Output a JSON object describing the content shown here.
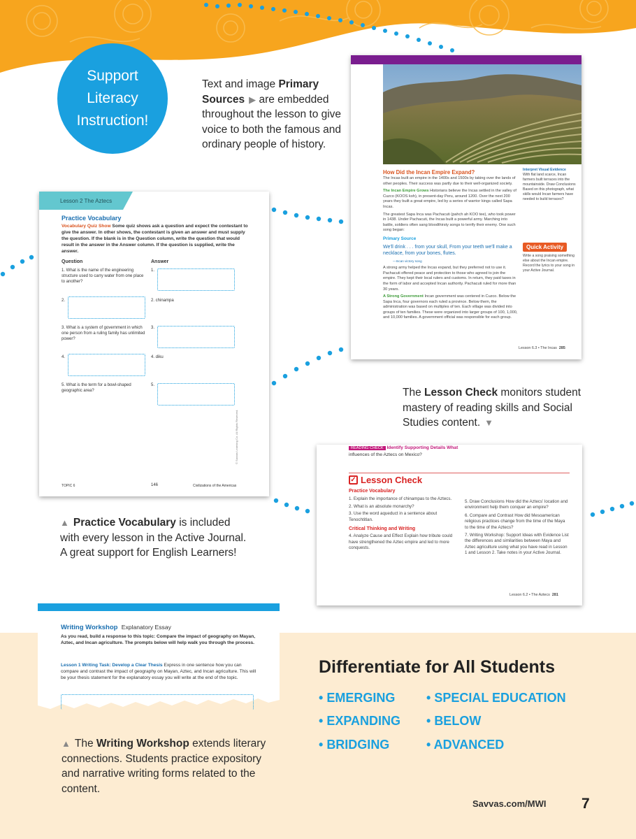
{
  "colors": {
    "orange": "#f7a51e",
    "blue": "#1aa0df",
    "teal": "#63c7cf",
    "red": "#d92323",
    "purple": "#7a1d8f",
    "cream": "#fdecd2"
  },
  "badge": {
    "line1": "Support",
    "line2": "Literacy",
    "line3": "Instruction!"
  },
  "captions": {
    "primary": {
      "pre": "Text and image ",
      "bold": "Primary Sources",
      "post": " are embedded throughout the lesson to give voice to both the famous and ordinary people of history.",
      "arrow_icon": "triangle-right-icon"
    },
    "lesson_check": {
      "pre": "The ",
      "bold": "Lesson Check",
      "post": " monitors student mastery of reading skills and Social Studies content.",
      "arrow_icon": "triangle-down-icon"
    },
    "practice": {
      "bold": "Practice Vocabulary",
      "post": " is included with every lesson in the Active Journal. A great support for English Learners!",
      "arrow_icon": "triangle-up-icon"
    },
    "writing": {
      "pre": "The ",
      "bold": "Writing Workshop",
      "post": " extends literary connections. Students practice expository and narrative writing forms related to the content.",
      "arrow_icon": "triangle-up-icon"
    }
  },
  "vocab_card": {
    "tab": "Lesson 2  The Aztecs",
    "title": "Practice Vocabulary",
    "lead": "Vocabulary Quiz Show",
    "instructions": " Some quiz shows ask a question and expect the contestant to give the answer. In other shows, the contestant is given an answer and must supply the question. If the blank is in the Question column, write the question that would result in the answer in the Answer column. If the question is supplied, write the answer.",
    "col_q": "Question",
    "col_a": "Answer",
    "rows": [
      {
        "q": "1. What is the name of the engineering structure used to carry water from one place to another?",
        "a": "1."
      },
      {
        "q": "2.",
        "a": "2. chinampa"
      },
      {
        "q": "3. What is a system of government in which one person from a ruling family has unlimited power?",
        "a": "3."
      },
      {
        "q": "4.",
        "a": "4. diku"
      },
      {
        "q": "5. What is the term for a bowl-shaped geographic area?",
        "a": "5."
      }
    ],
    "footer_left": "TOPIC 6",
    "footer_mid": "146",
    "footer_right": "Civilizations of the Americas",
    "copyright": "© Savvas Learning Co. All Rights Reserved."
  },
  "inca_card": {
    "heading": "How Did the Incan Empire Expand?",
    "p1": "The Incas built an empire in the 1400s and 1500s by taking over the lands of other peoples. Their success was partly due to their well-organized society.",
    "sub1": "The Incan Empire Grows",
    "p2": " Historians believe the Incas settled in the valley of Cuzco (KOOS koh), in present-day Peru, around 1200. Over the next 200 years they built a great empire, led by a series of warrior kings called Sapa Incas.",
    "p3": "The greatest Sapa Inca was Pachacuti (pahch ah KOO tee), who took power in 1438. Under Pachacuti, the Incas built a powerful army. Marching into battle, soldiers often sang bloodthirsty songs to terrify their enemy. One such song began:",
    "ps_label": "Primary Source",
    "quote": "We'll drink . . . from your skull, From your teeth we'll make a necklace, from your bones, flutes.",
    "quote_src": "—Incan victory song",
    "p4": "A strong army helped the Incas expand, but they preferred not to use it. Pachacuti offered peace and protection to those who agreed to join the empire. They kept their local rulers and customs. In return, they paid taxes in the form of labor and accepted Incan authority. Pachacuti ruled for more than 30 years.",
    "sub2": "A Strong Government",
    "p5": " Incan government was centered in Cuzco. Below the Sapa Inca, four governors each ruled a province. Below them, the administration was based on multiples of ten. Each village was divided into groups of ten families. These were organized into larger groups of 100, 1,000, and 10,000 families. A government official was responsible for each group.",
    "side_title": "Interpret Visual Evidence",
    "side_text": "With flat land scarce, Incan farmers built terraces into the mountainside. Draw Conclusions Based on this photograph, what skills would Incan farmers have needed to build terraces?",
    "quick_activity": "Quick Activity",
    "quick_text": "Write a song praising something else about the Incan empire. Record the lyrics to your song in your Active Journal.",
    "footer": "Lesson 6.3 • The Incas",
    "page": "285"
  },
  "lesson_check_card": {
    "reading_check": "READING CHECK",
    "rc_text": " Identify Supporting Details What",
    "rc_text2": "influences of the Aztecs on Mexico?",
    "title": "Lesson Check",
    "pv_head": "Practice Vocabulary",
    "items_left": [
      "1.  Explain the importance of chinampas to the Aztecs.",
      "2.  What is an absolute monarchy?",
      "3.  Use the word aqueduct in a sentence about Tenochtitlan."
    ],
    "ct_head": "Critical Thinking and Writing",
    "item4": "4.  Analyze Cause and Effect Explain how tribute could have strengthened the Aztec empire and led to more conquests.",
    "items_right": [
      "5.  Draw Conclusions How did the Aztecs' location and environment help them conquer an empire?",
      "6.  Compare and Contrast How did Mesoamerican religious practices change from the time of the Maya to the time of the Aztecs?",
      "7.  Writing Workshop: Support Ideas with Evidence List the differences and similarities between Maya and Aztec agriculture using what you have read in Lesson 1 and Lesson 2. Take notes in your Active Journal."
    ],
    "footer": "Lesson 6.2 • The Aztecs",
    "page": "281"
  },
  "writing_card": {
    "title": "Writing Workshop",
    "subtitle": "Explanatory Essay",
    "intro": "As you read, build a response to this topic: Compare the impact of geography on Mayan, Aztec, and Incan agriculture. The prompts below will help walk you through the process.",
    "task_label": "Lesson 1 Writing Task: Develop a Clear Thesis",
    "task_text": " Express in one sentence how you can compare and contrast the impact of geography on Mayan, Aztec, and Incan agriculture. This will be your thesis statement for the explanatory essay you will write at the end of the topic."
  },
  "differentiate": {
    "title": "Differentiate for All Students",
    "col1": [
      "EMERGING",
      "EXPANDING",
      "BRIDGING"
    ],
    "col2": [
      "SPECIAL EDUCATION",
      "BELOW",
      "ADVANCED"
    ]
  },
  "footer": {
    "url": "Savvas.com/MWI",
    "page": "7"
  }
}
